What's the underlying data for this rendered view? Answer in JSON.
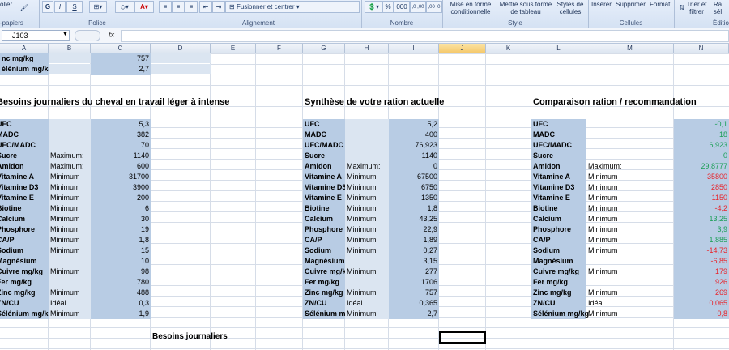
{
  "ribbon": {
    "clipboard_label": "-papiers",
    "clipboard_btn": "oller",
    "font_label": "Police",
    "bold": "G",
    "italic": "I",
    "underline": "S",
    "alignment_label": "Alignement",
    "merge_center": "Fusionner et centrer",
    "number_label": "Nombre",
    "percent": "%",
    "thousands": "000",
    "dec_inc": ",0 ,00",
    "dec_dec": ",00 ,0",
    "style_label": "Style",
    "cond_format": "Mise en forme conditionnelle",
    "table_format": "Mettre sous forme de tableau",
    "cell_styles": "Styles de cellules",
    "cells_label": "Cellules",
    "insert": "Insérer",
    "delete": "Supprimer",
    "format": "Format",
    "edit_label": "Éditio",
    "sort_filter": "Trier et filtrer",
    "find": "Ra sél"
  },
  "formula_bar": {
    "name_box": "J103",
    "fx": "fx",
    "content": ""
  },
  "columns": [
    "A",
    "B",
    "C",
    "D",
    "E",
    "F",
    "G",
    "H",
    "I",
    "J",
    "K",
    "L",
    "M",
    "N"
  ],
  "top_rows": [
    {
      "a": "nc mg/kg",
      "c": "757"
    },
    {
      "a": "élénium mg/kg",
      "c": "2,7"
    }
  ],
  "section1": {
    "title": "Besoins journaliers du cheval en travail léger à intense",
    "rows": [
      {
        "name": "UFC",
        "qual": "",
        "val": "5,3"
      },
      {
        "name": "MADC",
        "qual": "",
        "val": "382"
      },
      {
        "name": "UFC/MADC",
        "qual": "",
        "val": "70"
      },
      {
        "name": "Sucre",
        "qual": "Maximum:",
        "val": "1140"
      },
      {
        "name": "Amidon",
        "qual": "Maximum:",
        "val": "600"
      },
      {
        "name": "Vitamine A",
        "qual": "Minimum",
        "val": "31700"
      },
      {
        "name": "Vitamine D3",
        "qual": "Minimum",
        "val": "3900"
      },
      {
        "name": "Vitamine E",
        "qual": "Minimum",
        "val": "200"
      },
      {
        "name": "Biotine",
        "qual": "Minimum",
        "val": "6"
      },
      {
        "name": "Calcium",
        "qual": "Minimum",
        "val": "30"
      },
      {
        "name": "Phosphore",
        "qual": "Minimum",
        "val": "19"
      },
      {
        "name": "CA/P",
        "qual": "Minimum",
        "val": "1,8"
      },
      {
        "name": "Sodium",
        "qual": "Minimum",
        "val": "15"
      },
      {
        "name": "Magnésium",
        "qual": "",
        "val": "10"
      },
      {
        "name": "Cuivre mg/kg",
        "qual": "Minimum",
        "val": "98"
      },
      {
        "name": "Fer mg/kg",
        "qual": "",
        "val": "780"
      },
      {
        "name": "Zinc mg/kg",
        "qual": "Minimum",
        "val": "488"
      },
      {
        "name": "ZN/CU",
        "qual": "Idéal",
        "val": "0,3"
      },
      {
        "name": "Sélénium mg/kg",
        "qual": "Minimum",
        "val": "1,9"
      }
    ],
    "labels_display": [
      "UFC",
      "MADC",
      "UFC/MADC",
      "Sucre",
      "Amidon",
      "Vitamine A",
      "Vitamine D3",
      "Vitamine E",
      "Biotine",
      "Calcium",
      "Phosphore",
      "CA/P",
      "Sodium",
      "Magnésium",
      "Cuivre mg/kg",
      "Fer mg/kg",
      "Zinc mg/kg",
      "ZN/CU",
      "Sélénium mg/kg"
    ]
  },
  "section2": {
    "title": "Synthèse de votre ration actuelle",
    "rows": [
      {
        "name": "UFC",
        "qual": "",
        "val": "5,2"
      },
      {
        "name": "MADC",
        "qual": "",
        "val": "400"
      },
      {
        "name": "UFC/MADC",
        "qual": "",
        "val": "76,923"
      },
      {
        "name": "Sucre",
        "qual": "",
        "val": "1140"
      },
      {
        "name": "Amidon",
        "qual": "Maximum:",
        "val": "0"
      },
      {
        "name": "Vitamine A",
        "qual": "Minimum",
        "val": "67500"
      },
      {
        "name": "Vitamine D3",
        "qual": "Minimum",
        "val": "6750"
      },
      {
        "name": "Vitamine E",
        "qual": "Minimum",
        "val": "1350"
      },
      {
        "name": "Biotine",
        "qual": "Minimum",
        "val": "1,8"
      },
      {
        "name": "Calcium",
        "qual": "Minimum",
        "val": "43,25"
      },
      {
        "name": "Phosphore",
        "qual": "Minimum",
        "val": "22,9"
      },
      {
        "name": "CA/P",
        "qual": "Minimum",
        "val": "1,89"
      },
      {
        "name": "Sodium",
        "qual": "Minimum",
        "val": "0,27"
      },
      {
        "name": "Magnésium",
        "qual": "",
        "val": "3,15"
      },
      {
        "name": "Cuivre mg/kg",
        "qual": "Minimum",
        "val": "277"
      },
      {
        "name": "Fer mg/kg",
        "qual": "",
        "val": "1706"
      },
      {
        "name": "Zinc mg/kg",
        "qual": "Minimum",
        "val": "757"
      },
      {
        "name": "ZN/CU",
        "qual": "Idéal",
        "val": "0,365"
      },
      {
        "name": "Sélénium mg/kg",
        "qual": "Minimum",
        "val": "2,7"
      }
    ]
  },
  "section3": {
    "title": "Comparaison ration / recommandation",
    "rows": [
      {
        "name": "UFC",
        "qual": "",
        "val": "-0,1",
        "color": "green"
      },
      {
        "name": "MADC",
        "qual": "",
        "val": "18",
        "color": "green"
      },
      {
        "name": "UFC/MADC",
        "qual": "",
        "val": "6,923",
        "color": "green"
      },
      {
        "name": "Sucre",
        "qual": "",
        "val": "0",
        "color": "green"
      },
      {
        "name": "Amidon",
        "qual": "Maximum:",
        "val": "29,8777",
        "color": "green"
      },
      {
        "name": "Vitamine A",
        "qual": "Minimum",
        "val": "35800",
        "color": "red"
      },
      {
        "name": "Vitamine D3",
        "qual": "Minimum",
        "val": "2850",
        "color": "red"
      },
      {
        "name": "Vitamine E",
        "qual": "Minimum",
        "val": "1150",
        "color": "red"
      },
      {
        "name": "Biotine",
        "qual": "Minimum",
        "val": "-4,2",
        "color": "red"
      },
      {
        "name": "Calcium",
        "qual": "Minimum",
        "val": "13,25",
        "color": "green"
      },
      {
        "name": "Phosphore",
        "qual": "Minimum",
        "val": "3,9",
        "color": "green"
      },
      {
        "name": "CA/P",
        "qual": "Minimum",
        "val": "1,885",
        "color": "green"
      },
      {
        "name": "Sodium",
        "qual": "Minimum",
        "val": "-14,73",
        "color": "red"
      },
      {
        "name": "Magnésium",
        "qual": "",
        "val": "-6,85",
        "color": "red"
      },
      {
        "name": "Cuivre mg/kg",
        "qual": "Minimum",
        "val": "179",
        "color": "red"
      },
      {
        "name": "Fer mg/kg",
        "qual": "",
        "val": "926",
        "color": "red"
      },
      {
        "name": "Zinc mg/kg",
        "qual": "Minimum",
        "val": "269",
        "color": "red"
      },
      {
        "name": "ZN/CU",
        "qual": "Idéal",
        "val": "0,065",
        "color": "red"
      },
      {
        "name": "Sélénium mg/kg",
        "qual": "Minimum",
        "val": "0,8",
        "color": "red"
      }
    ]
  },
  "bottom": {
    "title": "Besoins journaliers"
  },
  "colors": {
    "fill_a": "#b8cce4",
    "fill_b": "#dbe5f1",
    "green": "#1a9e55",
    "red": "#e8232a"
  }
}
